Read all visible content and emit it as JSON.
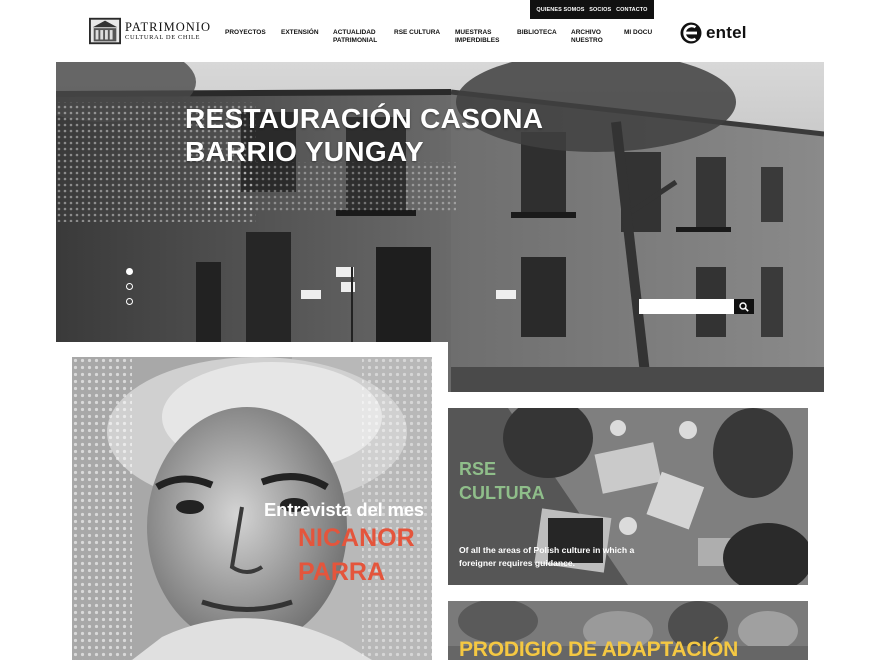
{
  "topbar": {
    "links": [
      {
        "label": "QUIENES SOMOS"
      },
      {
        "label": "SOCIOS"
      },
      {
        "label": "CONTACTO"
      }
    ]
  },
  "logo": {
    "line1": "PATRIMONIO",
    "line2": "CULTURAL DE CHILE"
  },
  "nav": {
    "items": [
      {
        "line1": "PROYECTOS",
        "line2": ""
      },
      {
        "line1": "EXTENSIÓN",
        "line2": ""
      },
      {
        "line1": "ACTUALIDAD",
        "line2": "PATRIMONIAL"
      },
      {
        "line1": "RSE CULTURA",
        "line2": ""
      },
      {
        "line1": "MUESTRAS",
        "line2": "IMPERDIBLES"
      },
      {
        "line1": "BIBLIOTECA",
        "line2": ""
      },
      {
        "line1": "ARCHIVO",
        "line2": "NUESTRO"
      },
      {
        "line1": "MI DOCU",
        "line2": ""
      }
    ]
  },
  "sponsor": {
    "name": "entel",
    "icon": "entel-logo-icon"
  },
  "hero": {
    "title_line1": "RESTAURACIÓN CASONA",
    "title_line2": "BARRIO YUNGAY",
    "slides": 3,
    "active_slide": 1,
    "search": {
      "value": "",
      "placeholder": "",
      "icon": "search-icon"
    }
  },
  "feature": {
    "kicker": "Entrevista del mes",
    "name_line1": "NICANOR",
    "name_line2": "PARRA",
    "accent": "#e4553c"
  },
  "rse_card": {
    "title_line1": "RSE",
    "title_line2": "CULTURA",
    "text": "Of all the areas of Polish culture in which a foreigner requires guidance.",
    "accent": "#8fbe8a"
  },
  "prodigio_card": {
    "title": "PRODIGIO DE ADAPTACIÓN",
    "accent": "#f5c842"
  }
}
